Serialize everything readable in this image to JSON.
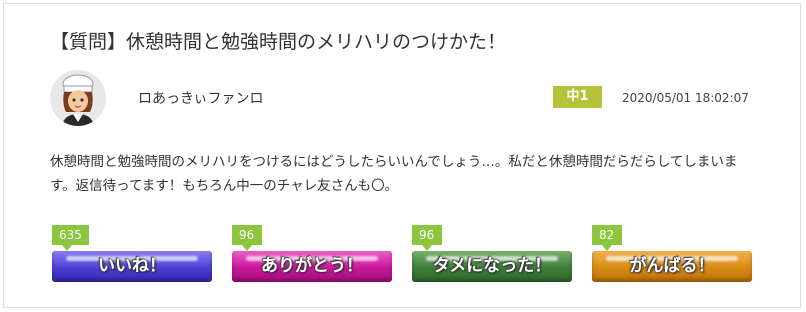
{
  "post": {
    "title": "【質問】休憩時間と勉強時間のメリハリのつけかた！",
    "username": "ロあっきぃファンロ",
    "grade": "中1",
    "datetime": "2020/05/01 18:02:07",
    "body": "休憩時間と勉強時間のメリハリをつけるにはどうしたらいいんでしょう…。私だと休憩時間だらだらしてしまいます。返信待ってます！もちろん中一のチャレ友さんも〇。"
  },
  "reactions": [
    {
      "count": "635",
      "label": "いいね！",
      "color": "#4b3fd3"
    },
    {
      "count": "96",
      "label": "ありがとう！",
      "color": "#c8179a"
    },
    {
      "count": "96",
      "label": "タメになった！",
      "color": "#3e7c3a"
    },
    {
      "count": "82",
      "label": "がんばる！",
      "color": "#d98a16"
    }
  ]
}
